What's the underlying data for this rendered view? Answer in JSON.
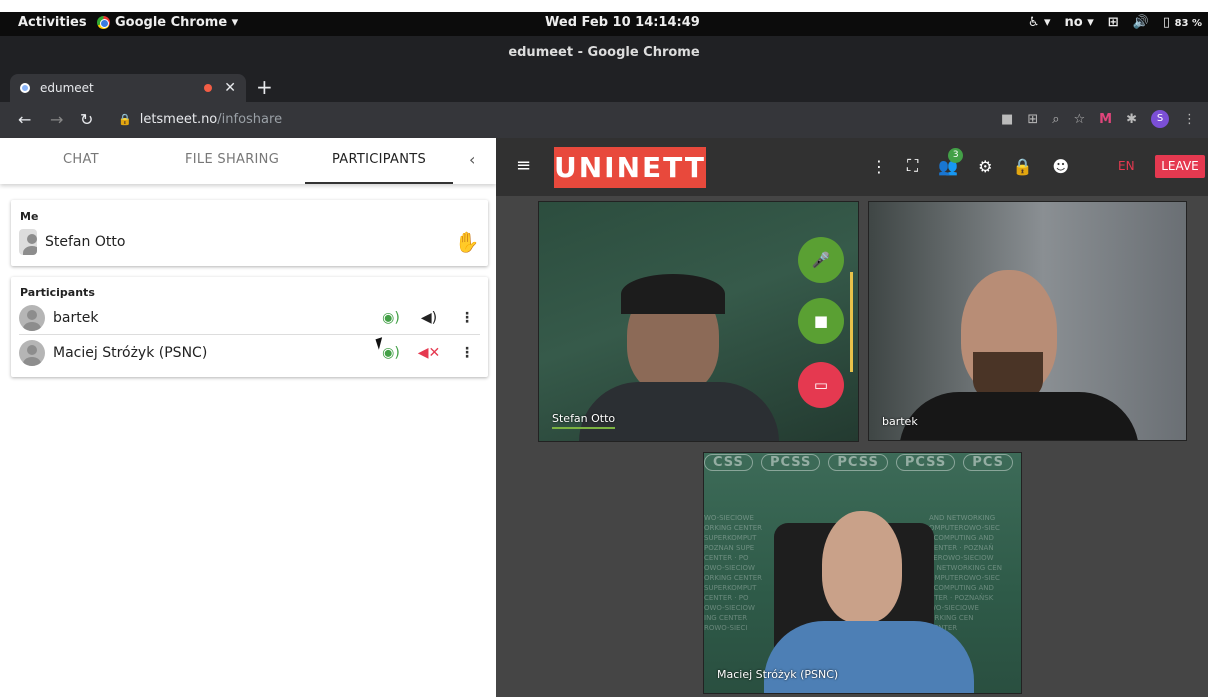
{
  "system_bar": {
    "activities": "Activities",
    "app_menu": "Google Chrome ▾",
    "clock": "Wed Feb 10  14:14:49",
    "keyboard": "no ▾",
    "battery": "83 %"
  },
  "window": {
    "title": "edumeet - Google Chrome"
  },
  "browser": {
    "tab_title": "edumeet",
    "url_host": "letsmeet.no",
    "url_path": "/infoshare",
    "profile_initial": "S"
  },
  "panel": {
    "tabs": [
      "CHAT",
      "FILE SHARING",
      "PARTICIPANTS"
    ],
    "me_heading": "Me",
    "me_name": "Stefan Otto",
    "participants_heading": "Participants",
    "participants": [
      {
        "name": "bartek"
      },
      {
        "name": "Maciej Stróżyk (PSNC)"
      }
    ]
  },
  "app": {
    "logo": "UNINETT",
    "participant_count": "3",
    "language": "EN",
    "leave": "LEAVE"
  },
  "videos": [
    {
      "name": "Stefan Otto"
    },
    {
      "name": "bartek"
    },
    {
      "name": "Maciej Stróżyk (PSNC)"
    }
  ],
  "backdrop": {
    "logos": [
      "CSS",
      "PCSS",
      "PCSS",
      "PCSS",
      "PCS"
    ],
    "lines": [
      "WO-SIECIOWE",
      "ORKING CENTER",
      "SUPERKOMPUT",
      "POZNAN SUPE",
      "CENTER · PO",
      "OWO-SIECIOW",
      "ORKING CENTER",
      "SUPERKOMPUT",
      "CENTER · PO",
      "OWO-SIECIOW",
      "ING CENTER",
      "ROWO-SIECI"
    ],
    "lines_right": [
      "AND NETWORKING",
      "OMPUTEROWO-SIEC",
      "RCOMPUTING AND",
      "CENTER · POZNAŃ",
      "TEROWO-SIECIOW",
      "D NETWORKING CEN",
      "OMPUTEROWO-SIEC",
      "RCOMPUTING AND",
      "NTER · POZNAŃSK",
      "WO-SIECIOWE",
      "ORKING CEN",
      "CENTER"
    ]
  },
  "colors": {
    "accent_red": "#e53950",
    "logo_red": "#e8493c",
    "green": "#43a047"
  }
}
